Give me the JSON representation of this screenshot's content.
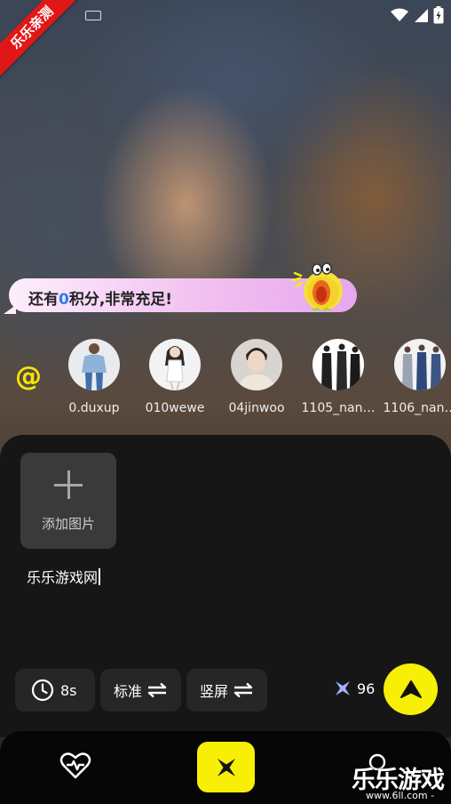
{
  "ribbon": {
    "text": "乐乐亲测"
  },
  "status": {
    "icons": [
      "keyboard-icon",
      "wifi-icon",
      "signal-icon",
      "battery-icon"
    ]
  },
  "bubble": {
    "prefix": "还有",
    "number": "0",
    "suffix": "积分,非常充足!"
  },
  "mention_symbol": "@",
  "avatars": [
    {
      "label": "0.duxup"
    },
    {
      "label": "010wewe"
    },
    {
      "label": "04jinwoo"
    },
    {
      "label": "1105_nan…"
    },
    {
      "label": "1106_nan…"
    }
  ],
  "add_image": {
    "label": "添加图片"
  },
  "prompt": {
    "text": "乐乐游戏网"
  },
  "options": {
    "duration": "8s",
    "quality": "标准",
    "orientation": "竖屏"
  },
  "credits": {
    "value": "96"
  },
  "watermark": {
    "main": "乐乐游戏",
    "sub": "www.6ll.com -"
  },
  "colors": {
    "accent": "#f7ef05",
    "number": "#2d7cf0",
    "ribbon": "#e11717"
  }
}
